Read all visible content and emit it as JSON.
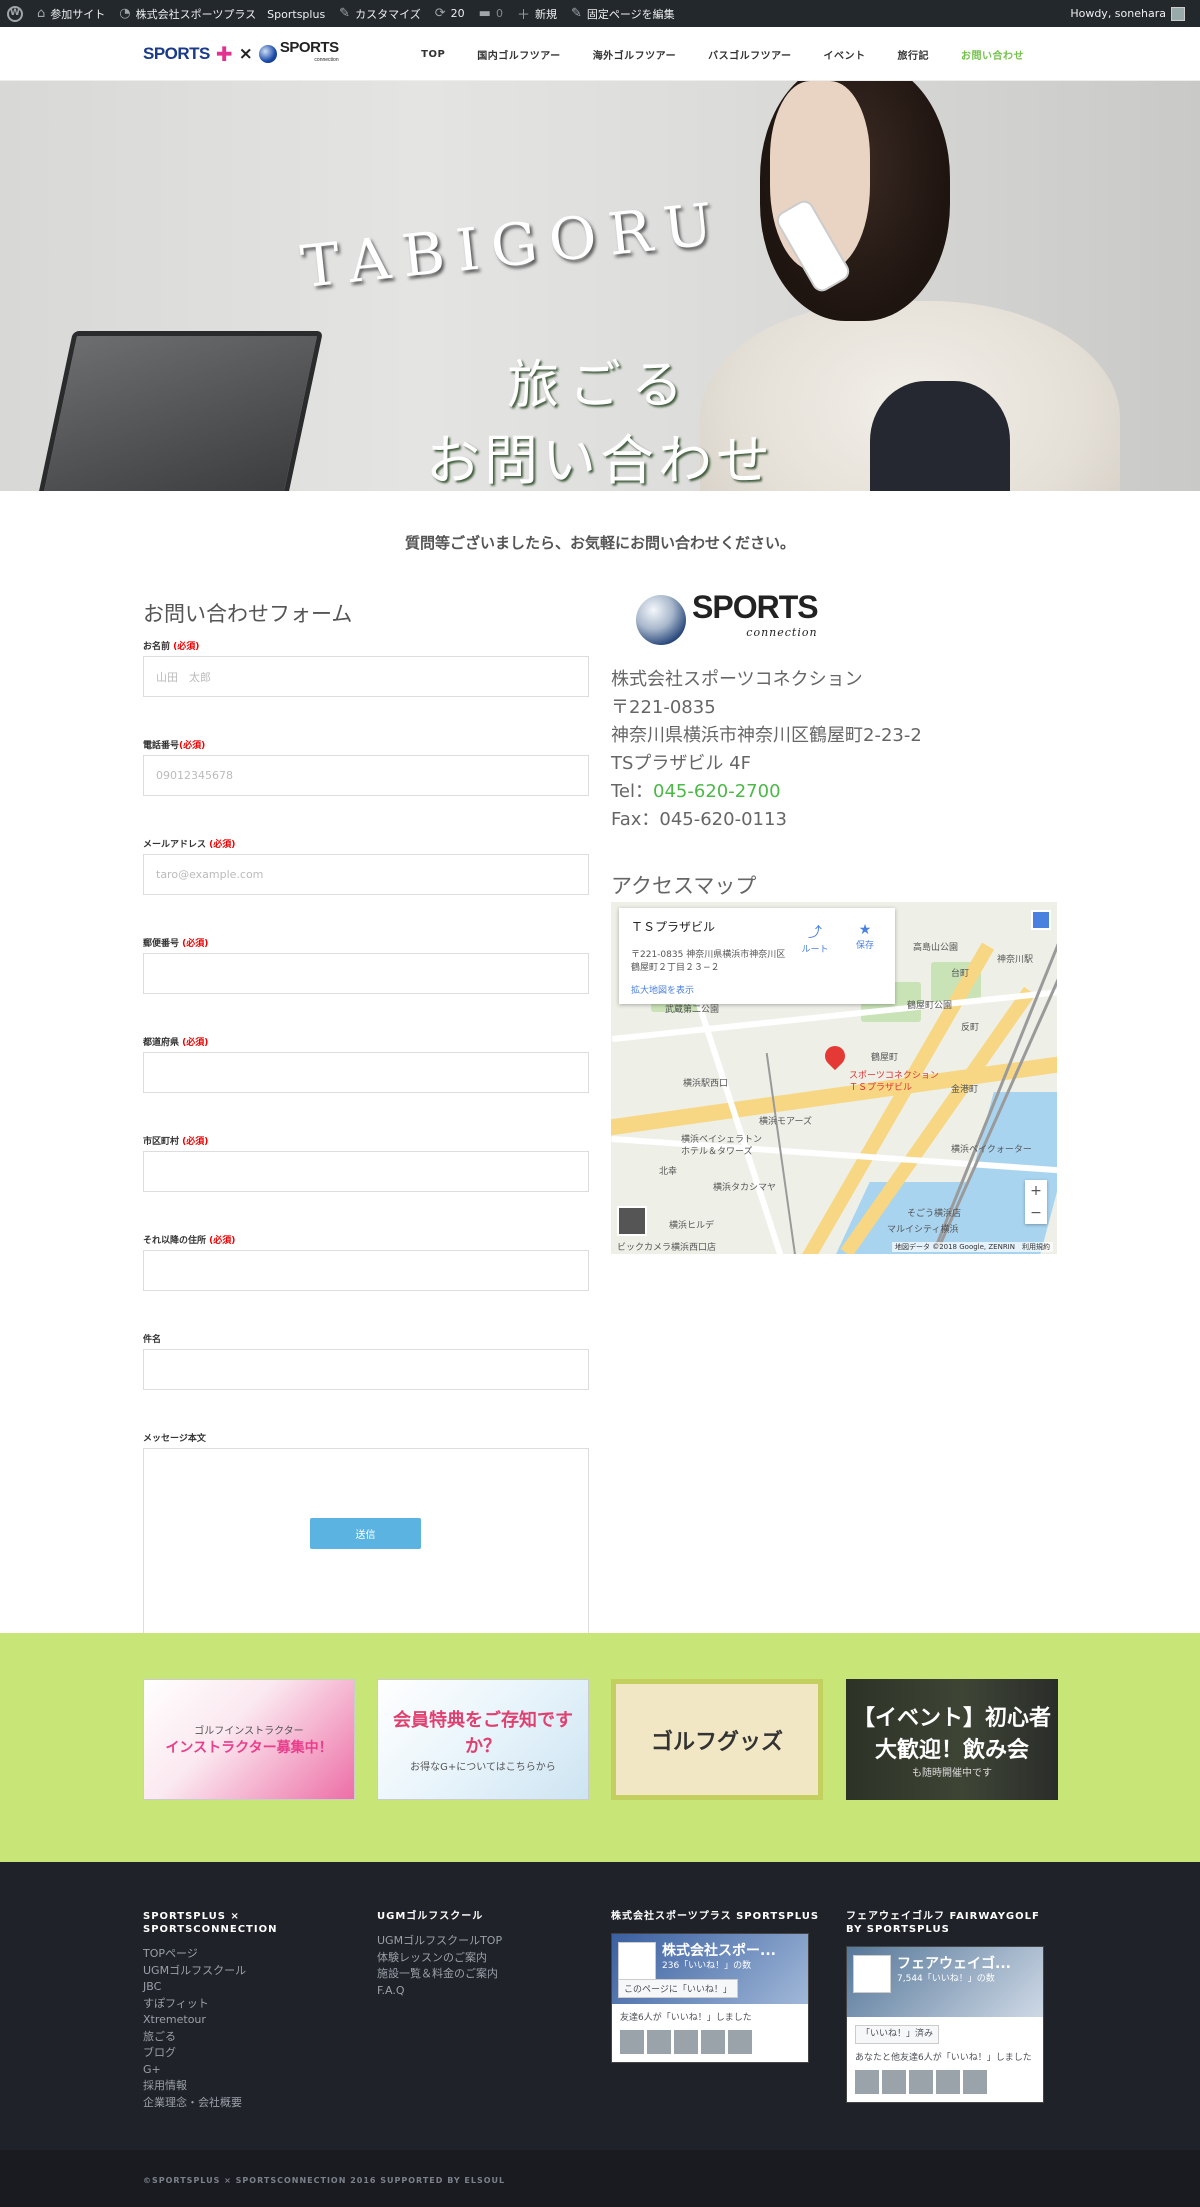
{
  "adminbar": {
    "site_label": "参加サイト",
    "site_name": "株式会社スポーツプラス　Sportsplus",
    "customize": "カスタマイズ",
    "updates_count": "20",
    "comments_count": "0",
    "new_label": "新規",
    "edit_label": "固定ページを編集",
    "howdy": "Howdy, sonehara"
  },
  "header": {
    "logo_left": "SPORTS",
    "logo_x": "×",
    "logo_right": "SPORTS",
    "logo_right_sub": "connection",
    "nav": [
      "TOP",
      "国内ゴルフツアー",
      "海外ゴルフツアー",
      "バスゴルフツアー",
      "イベント",
      "旅行記",
      "お問い合わせ"
    ]
  },
  "hero": {
    "title_en": "TABIGORU",
    "title_jp": "旅ごる",
    "subtitle_jp": "お問い合わせ"
  },
  "intro": "質問等ございましたら、お気軽にお問い合わせください。",
  "form": {
    "title": "お問い合わせフォーム",
    "required_mark": "(必須)",
    "fields": [
      {
        "label": "お名前 ",
        "required": true,
        "placeholder": "山田　太郎"
      },
      {
        "label": "電話番号",
        "required": true,
        "placeholder": "09012345678"
      },
      {
        "label": "メールアドレス ",
        "required": true,
        "placeholder": "taro@example.com"
      },
      {
        "label": "郵便番号 ",
        "required": true,
        "placeholder": ""
      },
      {
        "label": "都道府県 ",
        "required": true,
        "placeholder": ""
      },
      {
        "label": "市区町村 ",
        "required": true,
        "placeholder": ""
      },
      {
        "label": "それ以降の住所 ",
        "required": true,
        "placeholder": ""
      },
      {
        "label": "件名",
        "required": false,
        "placeholder": ""
      }
    ],
    "message_label": "メッセージ本文",
    "submit": "送信"
  },
  "company": {
    "logo_text": "SPORTS",
    "logo_sub": "connection",
    "name": "株式会社スポーツコネクション",
    "postal": "〒221-0835",
    "address": "神奈川県横浜市神奈川区鶴屋町2-23-2",
    "building": "TSプラザビル 4F",
    "tel_label": "Tel：",
    "tel": "045-620-2700",
    "fax": "Fax：045-620-0113",
    "map_title": "アクセスマップ"
  },
  "map": {
    "place_name": "ＴＳプラザビル",
    "place_address_1": "〒221-0835 神奈川県横浜市神奈川区",
    "place_address_2": "鶴屋町２丁目２３−２",
    "route_label": "ルート",
    "save_label": "保存",
    "enlarge_link": "拡大地図を表示",
    "labels": [
      "高島山公園",
      "神奈川駅",
      "台町",
      "鶴屋町公園",
      "反町",
      "鶴屋町",
      "横浜駅西口",
      "スポーツコネクション",
      "ＴＳプラザビル",
      "横浜モアーズ",
      "横浜ベイシェラトン",
      "ホテル＆タワーズ",
      "北幸",
      "横浜タカシマヤ",
      "ビックカメラ横浜西口店",
      "横浜ヒルデ",
      "そごう横浜店",
      "マルイシティ横浜",
      "金港町",
      "横浜ベイクォーター",
      "武蔵第二公園"
    ],
    "zoom_in": "+",
    "zoom_out": "−",
    "credit": "地図データ ©2018 Google, ZENRIN　利用規約"
  },
  "banners": [
    {
      "title": "インストラクター募集中！",
      "sub": "ゴルフインストラクター"
    },
    {
      "title": "会員特典をご存知ですか？",
      "sub": "お得なG+についてはこちらから"
    },
    {
      "title": "ゴルフグッズ",
      "sub": ""
    },
    {
      "title": "【イベント】初心者大歓迎！飲み会",
      "sub": "も随時開催中です"
    }
  ],
  "footer": {
    "col1": {
      "heading": "SPORTSPLUS × SPORTSCONNECTION",
      "links": [
        "TOPページ",
        "UGMゴルフスクール",
        "JBC",
        "すぽフィット",
        "Xtremetour",
        "旅ごる",
        "ブログ",
        "G+",
        "採用情報",
        "企業理念・会社概要"
      ]
    },
    "col2": {
      "heading": "UGMゴルフスクール",
      "links": [
        "UGMゴルフスクールTOP",
        "体験レッスンのご案内",
        "施設一覧＆料金のご案内",
        "F.A.Q"
      ]
    },
    "col3": {
      "heading": "株式会社スポーツプラス SPORTSPLUS",
      "fb_name": "株式会社スポー...",
      "fb_likes": "236「いいね！」の数",
      "fb_button": "このページに「いいね！」",
      "fb_friends": "友達6人が「いいね！」しました"
    },
    "col4": {
      "heading": "フェアウェイゴルフ FAIRWAYGOLF BY SPORTSPLUS",
      "fb_name": "フェアウェイゴ...",
      "fb_likes": "7,544「いいね！」の数",
      "fb_button": "「いいね！」済み",
      "fb_friends": "あなたと他友達6人が「いいね！」しました"
    }
  },
  "copyright": "©SPORTSPLUS × SPORTSCONNECTION 2016 SUPPORTED BY ELSOUL",
  "colors": {
    "accent_green": "#73c04b",
    "banner_bg": "#c8e678",
    "submit_blue": "#5ab3e0",
    "footer_bg": "#1f2228"
  }
}
